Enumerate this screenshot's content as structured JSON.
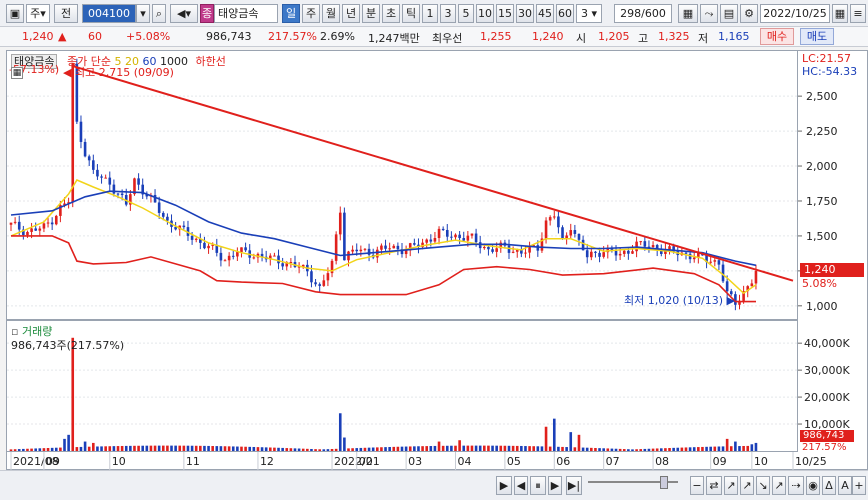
{
  "toolbar": {
    "mode": "주",
    "prev_label": "전",
    "code": "004100",
    "badge": "종",
    "name": "태양금속",
    "periods": [
      "일",
      "주",
      "월",
      "년",
      "분",
      "초",
      "틱"
    ],
    "active_period": "일",
    "minutes": [
      "1",
      "3",
      "5",
      "10",
      "15",
      "30",
      "45",
      "60"
    ],
    "minute_sel": "3",
    "count": "298/600",
    "date": "2022/10/25"
  },
  "quote": {
    "price": "1,240",
    "arrow": "▲",
    "change": "60",
    "change_pct": "+5.08%",
    "volume": "986,743",
    "vol_ratio": "217.57%",
    "turnover": "2.69%",
    "amount": "1,247백만",
    "best_label": "최우선",
    "best_ask": "1,255",
    "best_bid": "1,240",
    "open_label": "시",
    "open": "1,205",
    "high_label": "고",
    "high": "1,325",
    "low_label": "저",
    "low": "1,165",
    "buy_label": "매수",
    "sell_label": "매도"
  },
  "legend": {
    "name": "태양금속",
    "ma_label": "종가 단순",
    "ma5": "5",
    "ma20": "20",
    "ma60": "60",
    "ma1000": "1000",
    "lower": "하한선",
    "lc": "LC:21.57",
    "hc": "HC:-54.33",
    "left_pct": "-57.13%)",
    "high_note": "최고 2,715 (09/09)",
    "low_note": "최저 1,020 (10/13)",
    "vol_title": "거래량",
    "vol_note": "986,743주(217.57%)",
    "current_price_tag": "1,240",
    "current_pct_tag": "5.08%",
    "vol_tag": "986,743",
    "vol_pct_tag": "217.57%"
  },
  "colors": {
    "up": "#e0201c",
    "down": "#1a3fb8",
    "ma5": "#f2d41a",
    "ma20": "#1a3fb8",
    "env": "#e0201c",
    "trend": "#e0201c"
  },
  "chart_data": {
    "type": "candlestick",
    "title": "태양금속",
    "price_ticks": [
      "2,500",
      "2,250",
      "2,000",
      "1,750",
      "1,500",
      "1,250",
      "1,000"
    ],
    "price_tick_values": [
      2500,
      2250,
      2000,
      1750,
      1500,
      1250,
      1000
    ],
    "ylim": [
      920,
      2780
    ],
    "vol_ticks": [
      "40,000K",
      "30,000K",
      "20,000K",
      "10,000K"
    ],
    "vol_tick_values": [
      40000,
      30000,
      20000,
      10000
    ],
    "vol_ylim": [
      0,
      46000
    ],
    "x_labels": [
      "2021/08",
      "09",
      "10",
      "11",
      "12",
      "2022/01",
      "02",
      "03",
      "04",
      "05",
      "06",
      "07",
      "08",
      "09",
      "10",
      "10/25"
    ],
    "price_path": [
      [
        0,
        1580
      ],
      [
        4,
        1530
      ],
      [
        8,
        1560
      ],
      [
        10,
        1620
      ],
      [
        12,
        1700
      ],
      [
        14,
        1750
      ],
      [
        15,
        2715
      ],
      [
        16,
        2300
      ],
      [
        18,
        2100
      ],
      [
        20,
        1950
      ],
      [
        24,
        1880
      ],
      [
        28,
        1720
      ],
      [
        30,
        1900
      ],
      [
        34,
        1760
      ],
      [
        38,
        1600
      ],
      [
        40,
        1570
      ],
      [
        44,
        1490
      ],
      [
        48,
        1420
      ],
      [
        52,
        1330
      ],
      [
        55,
        1390
      ],
      [
        60,
        1360
      ],
      [
        64,
        1330
      ],
      [
        68,
        1300
      ],
      [
        72,
        1250
      ],
      [
        75,
        1120
      ],
      [
        78,
        1300
      ],
      [
        80,
        1700
      ],
      [
        81,
        1350
      ],
      [
        84,
        1400
      ],
      [
        88,
        1380
      ],
      [
        92,
        1420
      ],
      [
        96,
        1400
      ],
      [
        100,
        1450
      ],
      [
        104,
        1520
      ],
      [
        108,
        1500
      ],
      [
        112,
        1480
      ],
      [
        116,
        1400
      ],
      [
        120,
        1420
      ],
      [
        124,
        1380
      ],
      [
        128,
        1420
      ],
      [
        130,
        1600
      ],
      [
        132,
        1650
      ],
      [
        134,
        1450
      ],
      [
        136,
        1580
      ],
      [
        138,
        1450
      ],
      [
        140,
        1350
      ],
      [
        144,
        1400
      ],
      [
        148,
        1360
      ],
      [
        152,
        1440
      ],
      [
        156,
        1420
      ],
      [
        160,
        1390
      ],
      [
        164,
        1370
      ],
      [
        168,
        1340
      ],
      [
        172,
        1310
      ],
      [
        174,
        1080
      ],
      [
        176,
        1020
      ],
      [
        178,
        1100
      ],
      [
        180,
        1180
      ],
      [
        181,
        1240
      ]
    ],
    "ma5": [
      [
        0,
        1500
      ],
      [
        8,
        1600
      ],
      [
        14,
        1800
      ],
      [
        16,
        1900
      ],
      [
        20,
        1850
      ],
      [
        26,
        1780
      ],
      [
        32,
        1700
      ],
      [
        40,
        1570
      ],
      [
        48,
        1450
      ],
      [
        56,
        1380
      ],
      [
        64,
        1330
      ],
      [
        72,
        1270
      ],
      [
        78,
        1250
      ],
      [
        84,
        1330
      ],
      [
        92,
        1380
      ],
      [
        100,
        1430
      ],
      [
        108,
        1470
      ],
      [
        116,
        1430
      ],
      [
        124,
        1400
      ],
      [
        130,
        1480
      ],
      [
        136,
        1480
      ],
      [
        144,
        1390
      ],
      [
        152,
        1410
      ],
      [
        160,
        1390
      ],
      [
        168,
        1340
      ],
      [
        174,
        1200
      ],
      [
        178,
        1090
      ],
      [
        181,
        1150
      ]
    ],
    "ma20": [
      [
        0,
        1650
      ],
      [
        10,
        1680
      ],
      [
        18,
        1780
      ],
      [
        24,
        1820
      ],
      [
        32,
        1810
      ],
      [
        40,
        1720
      ],
      [
        48,
        1600
      ],
      [
        56,
        1520
      ],
      [
        64,
        1480
      ],
      [
        72,
        1420
      ],
      [
        80,
        1360
      ],
      [
        88,
        1380
      ],
      [
        96,
        1400
      ],
      [
        104,
        1420
      ],
      [
        112,
        1440
      ],
      [
        120,
        1440
      ],
      [
        128,
        1420
      ],
      [
        136,
        1410
      ],
      [
        144,
        1410
      ],
      [
        152,
        1420
      ],
      [
        160,
        1400
      ],
      [
        168,
        1380
      ],
      [
        176,
        1320
      ],
      [
        181,
        1290
      ]
    ],
    "env_low": [
      [
        0,
        1500
      ],
      [
        10,
        1500
      ],
      [
        14,
        1450
      ],
      [
        16,
        1320
      ],
      [
        20,
        1300
      ],
      [
        28,
        1310
      ],
      [
        34,
        1350
      ],
      [
        40,
        1300
      ],
      [
        46,
        1250
      ],
      [
        50,
        1180
      ],
      [
        56,
        1170
      ],
      [
        66,
        1160
      ],
      [
        74,
        1100
      ],
      [
        80,
        1080
      ],
      [
        96,
        1080
      ],
      [
        104,
        1150
      ],
      [
        110,
        1260
      ],
      [
        118,
        1280
      ],
      [
        126,
        1260
      ],
      [
        134,
        1220
      ],
      [
        144,
        1230
      ],
      [
        156,
        1270
      ],
      [
        166,
        1230
      ],
      [
        172,
        1150
      ],
      [
        176,
        1030
      ],
      [
        181,
        1030
      ]
    ],
    "trendline": [
      [
        15,
        2715
      ],
      [
        190,
        1180
      ]
    ],
    "volume_spikes": [
      [
        15,
        42000
      ],
      [
        14,
        6000
      ],
      [
        13,
        4500
      ],
      [
        18,
        3500
      ],
      [
        20,
        3000
      ],
      [
        80,
        14000
      ],
      [
        81,
        5000
      ],
      [
        130,
        9000
      ],
      [
        132,
        12000
      ],
      [
        136,
        7000
      ],
      [
        138,
        6000
      ],
      [
        109,
        4000
      ],
      [
        104,
        3500
      ],
      [
        174,
        4500
      ],
      [
        176,
        3500
      ],
      [
        180,
        2500
      ],
      [
        181,
        3000
      ]
    ]
  }
}
